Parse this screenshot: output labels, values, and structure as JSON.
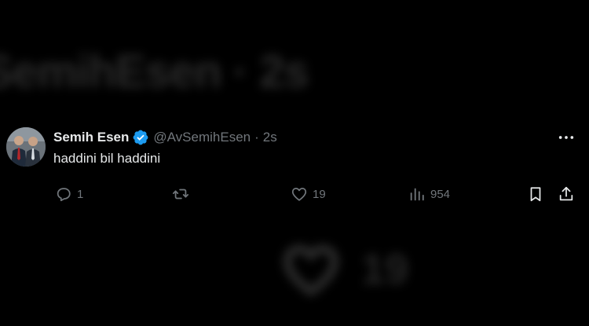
{
  "background": {
    "top_blurred_text": "SemihEsen · 2s",
    "bottom_blurred_like_count": "19"
  },
  "tweet": {
    "author_name": "Semih Esen",
    "handle": "@AvSemihEsen",
    "separator": "·",
    "time": "2s",
    "text": "haddini bil haddini",
    "verified": true,
    "actions": {
      "replies": "1",
      "retweets": "",
      "likes": "19",
      "views": "954"
    }
  },
  "colors": {
    "background": "#000000",
    "primary_text": "#e7e9ea",
    "secondary_text": "#71767b",
    "verified_blue": "#1d9bf0"
  },
  "icons": [
    "reply-icon",
    "retweet-icon",
    "like-icon",
    "views-icon",
    "bookmark-icon",
    "share-icon",
    "more-icon",
    "verified-badge-icon"
  ]
}
